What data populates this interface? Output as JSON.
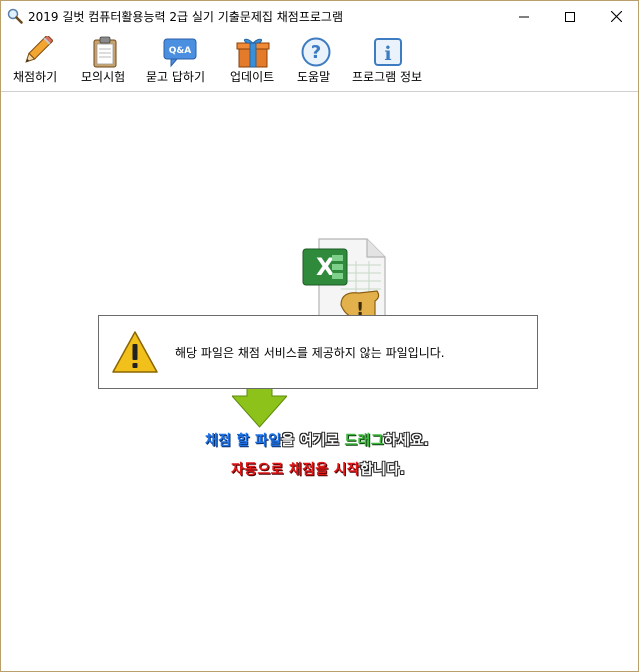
{
  "window": {
    "title": "2019 길벗 컴퓨터활용능력 2급 실기 기출문제집 채점프로그램"
  },
  "toolbar": {
    "items": [
      {
        "label": "채점하기",
        "icon": "pencil-icon"
      },
      {
        "label": "모의시험",
        "icon": "clipboard-icon"
      },
      {
        "label": "묻고 답하기",
        "icon": "qa-bubble-icon"
      },
      {
        "label": "업데이트",
        "icon": "gift-box-icon"
      },
      {
        "label": "도움말",
        "icon": "help-icon"
      },
      {
        "label": "프로그램 정보",
        "icon": "info-icon"
      }
    ],
    "qa_icon_text": "Q&A"
  },
  "dialog": {
    "message": "해당 파일은 채점 서비스를 제공하지 않는 파일입니다."
  },
  "instructions": {
    "line1": [
      {
        "text": "채점 할 파일",
        "color": "blue"
      },
      {
        "text": "을 여기로 ",
        "color": "white"
      },
      {
        "text": "드래그",
        "color": "green"
      },
      {
        "text": "하세요.",
        "color": "white"
      }
    ],
    "line2": [
      {
        "text": "자동으로 채점을 시작",
        "color": "red"
      },
      {
        "text": "합니다.",
        "color": "white"
      }
    ]
  },
  "colors": {
    "border": "#b8a06a",
    "arrow": "#8cc21a",
    "highlight_blue": "#1e73e8",
    "highlight_green": "#3fb83f",
    "highlight_red": "#e01818"
  }
}
